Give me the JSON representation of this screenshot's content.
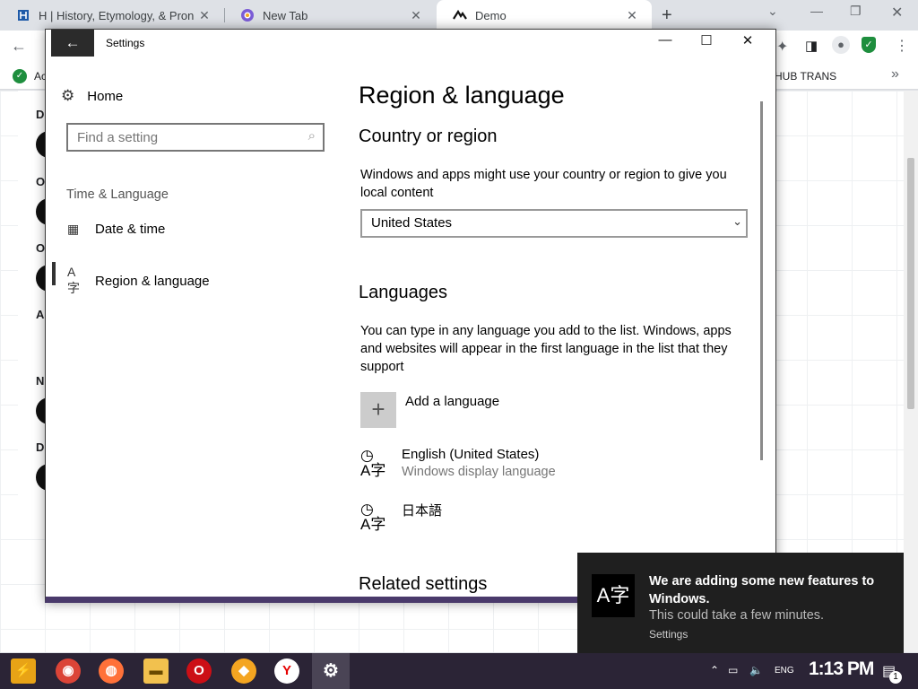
{
  "browser": {
    "tabs": [
      {
        "title": "H | History, Etymology, & Pron",
        "icon": "britannica-icon"
      },
      {
        "title": "New Tab",
        "icon": "browser-logo-icon"
      },
      {
        "title": "Demo",
        "icon": "demo-logo-icon",
        "active": true
      }
    ],
    "bookmark_label": "HUB TRANS",
    "bookmark_left": "Ac",
    "page_letters": [
      "D",
      "O",
      "O",
      "A",
      "N",
      "D"
    ]
  },
  "settings": {
    "window_title": "Settings",
    "nav": {
      "home": "Home",
      "search_placeholder": "Find a setting",
      "section": "Time & Language",
      "items": [
        {
          "label": "Date & time",
          "icon": "calendar-clock-icon"
        },
        {
          "label": "Region & language",
          "icon": "language-icon",
          "active": true
        }
      ]
    },
    "main": {
      "title": "Region & language",
      "country_heading": "Country or region",
      "country_desc": "Windows and apps might use your country or region to give you local content",
      "country_value": "United States",
      "languages_heading": "Languages",
      "languages_desc": "You can type in any language you add to the list. Windows, apps and websites will appear in the first language in the list that they support",
      "add_language": "Add a language",
      "languages": [
        {
          "name": "English (United States)",
          "sub": "Windows display language"
        },
        {
          "name": "日本語",
          "sub": ""
        }
      ],
      "related_heading": "Related settings"
    }
  },
  "toast": {
    "title": "We are adding some new features to Windows.",
    "body": "This could take a few minutes.",
    "source": "Settings"
  },
  "taskbar": {
    "lang": "ENG",
    "time": "1:13 PM",
    "notifications": "1"
  }
}
